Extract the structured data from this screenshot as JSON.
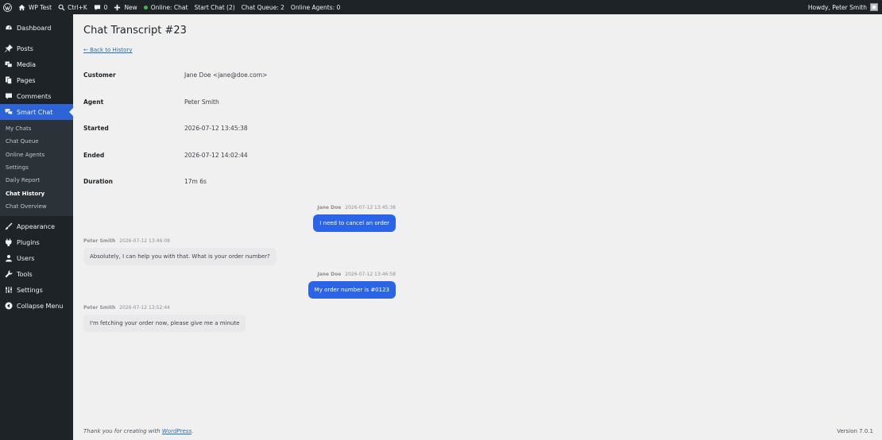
{
  "admin_bar": {
    "site_name": "WP Test",
    "search_shortcut": "Ctrl+K",
    "comments_count": "0",
    "new_label": "New",
    "online_status": "Online: Chat",
    "start_chat": "Start Chat (2)",
    "chat_queue": "Chat Queue: 2",
    "online_agents": "Online Agents: 0",
    "howdy": "Howdy, Peter Smith"
  },
  "sidebar": {
    "top_items": [
      {
        "label": "Dashboard",
        "icon": "dashboard-icon"
      },
      {
        "label": "Posts",
        "icon": "pin-icon"
      },
      {
        "label": "Media",
        "icon": "media-icon"
      },
      {
        "label": "Pages",
        "icon": "pages-icon"
      },
      {
        "label": "Comments",
        "icon": "comment-icon"
      },
      {
        "label": "Smart Chat",
        "icon": "chat-icon",
        "current": true
      }
    ],
    "submenu": [
      "My Chats",
      "Chat Queue",
      "Online Agents",
      "Settings",
      "Daily Report",
      "Chat History",
      "Chat Overview"
    ],
    "submenu_active": "Chat History",
    "bottom_items": [
      {
        "label": "Appearance",
        "icon": "brush-icon"
      },
      {
        "label": "Plugins",
        "icon": "plugin-icon"
      },
      {
        "label": "Users",
        "icon": "users-icon"
      },
      {
        "label": "Tools",
        "icon": "wrench-icon"
      },
      {
        "label": "Settings",
        "icon": "settings-icon"
      },
      {
        "label": "Collapse Menu",
        "icon": "collapse-icon"
      }
    ]
  },
  "main": {
    "title": "Chat Transcript #23",
    "back_link": "← Back to History",
    "details": [
      {
        "key": "Customer",
        "value": "Jane Doe <jane@doe.com>"
      },
      {
        "key": "Agent",
        "value": "Peter Smith"
      },
      {
        "key": "Started",
        "value": "2026-07-12 13:45:38"
      },
      {
        "key": "Ended",
        "value": "2026-07-12 14:02:44"
      },
      {
        "key": "Duration",
        "value": "17m 6s"
      }
    ],
    "messages": [
      {
        "sender": "Jane Doe",
        "time": "2026-07-12 13:45:38",
        "text": "I need to cancel an order",
        "role": "customer"
      },
      {
        "sender": "Peter Smith",
        "time": "2026-07-12 13:46:08",
        "text": "Absolutely, I can help you with that. What is your order number?",
        "role": "agent"
      },
      {
        "sender": "Jane Doe",
        "time": "2026-07-12 13:46:58",
        "text": "My order number is #0123",
        "role": "customer"
      },
      {
        "sender": "Peter Smith",
        "time": "2026-07-12 13:52:44",
        "text": "I'm fetching your order now, please give me a minute",
        "role": "agent"
      }
    ]
  },
  "footer": {
    "thanks_prefix": "Thank you for creating with ",
    "thanks_link": "WordPress",
    "thanks_suffix": ".",
    "version": "Version 7.0.1"
  },
  "colors": {
    "accent": "#2c64e8",
    "admin_bar": "#1d2327",
    "link": "#2271b1"
  }
}
